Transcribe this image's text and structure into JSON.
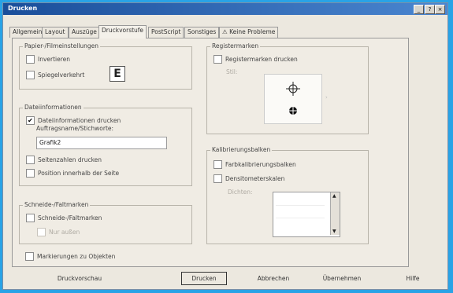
{
  "window": {
    "title": "Drucken"
  },
  "tabs": [
    {
      "label": "Allgemein"
    },
    {
      "label": "Layout"
    },
    {
      "label": "Auszüge"
    },
    {
      "label": "Druckvorstufe"
    },
    {
      "label": "PostScript"
    },
    {
      "label": "Sonstiges"
    },
    {
      "label": "Keine Probleme"
    }
  ],
  "paper": {
    "group_label": "Papier-/Filmeinstellungen",
    "invert_label": "Invertieren",
    "mirror_label": "Spiegelverkehrt",
    "mirror_glyph": "E"
  },
  "file_info": {
    "group_label": "Dateiinformationen",
    "print_info_label": "Dateiinformationen drucken",
    "print_info_checked": true,
    "check_mark": "✔",
    "job_name_label": "Auftragsname/Stichworte:",
    "job_name_value": "Grafik2",
    "page_numbers_label": "Seitenzahlen drucken",
    "position_label": "Position innerhalb der Seite"
  },
  "crop_marks": {
    "group_label": "Schneide-/Faltmarken",
    "print_label": "Schneide-/Faltmarken",
    "exterior_label": "Nur außen"
  },
  "object_marks_label": "Markierungen zu Objekten",
  "registration": {
    "group_label": "Registermarken",
    "print_label": "Registermarken drucken",
    "style_label": "Stil:"
  },
  "calibration": {
    "group_label": "Kalibrierungsbalken",
    "color_label": "Farbkalibrierungsbalken",
    "density_label": "Densitometerskalen",
    "densities_label": "Dichten:",
    "list_items": [
      "",
      "",
      ""
    ]
  },
  "buttons": {
    "preview": "Druckvorschau",
    "print": "Drucken",
    "cancel": "Abbrechen",
    "apply": "Übernehmen",
    "help": "Hilfe"
  }
}
